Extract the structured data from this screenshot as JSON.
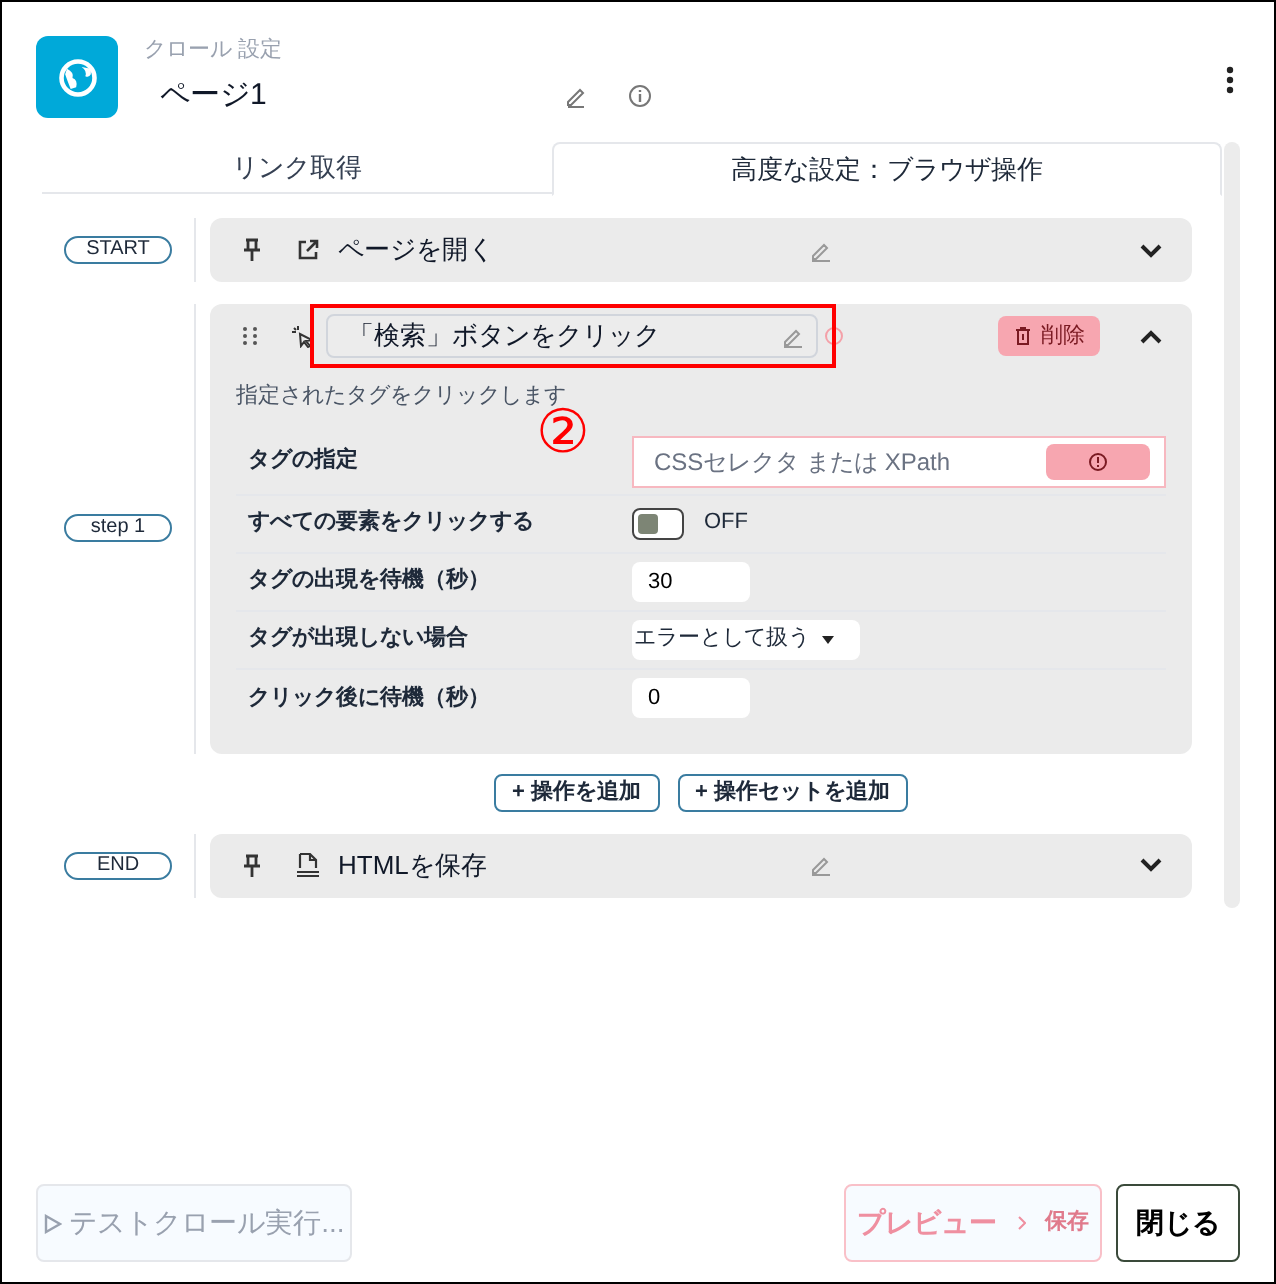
{
  "header": {
    "subtitle": "クロール 設定",
    "title": "ページ1"
  },
  "tabs": [
    {
      "label": "リンク取得",
      "selected": false
    },
    {
      "label": "高度な設定：ブラウザ操作",
      "selected": true
    }
  ],
  "steps": [
    {
      "badge": "START",
      "kind": "open_page",
      "title": "ページを開く",
      "expanded": false
    },
    {
      "badge": "step 1",
      "kind": "click",
      "title": "「検索」ボタンをクリック",
      "expanded": true,
      "highlighted": true,
      "delete_label": "削除",
      "description": "指定されたタグをクリックします",
      "annotation": "②",
      "fields": [
        {
          "kind": "selector",
          "label": "タグの指定",
          "placeholder": "CSSセレクタ または XPath",
          "invalid": true
        },
        {
          "kind": "toggle",
          "label": "すべての要素をクリックする",
          "on": false,
          "state_label": "OFF"
        },
        {
          "kind": "number",
          "label": "タグの出現を待機（秒）",
          "value": "30"
        },
        {
          "kind": "select",
          "label": "タグが出現しない場合",
          "value": "エラーとして扱う"
        },
        {
          "kind": "number",
          "label": "クリック後に待機（秒）",
          "value": "0"
        }
      ]
    },
    {
      "badge": "END",
      "kind": "save_html",
      "title": "HTMLを保存",
      "expanded": false
    }
  ],
  "add_buttons": [
    "+ 操作を追加",
    "+ 操作セットを追加"
  ],
  "footer": {
    "test_button": {
      "label": "テストクロール実行...",
      "disabled": true
    },
    "preview_button": {
      "label": "プレビュー",
      "save_label": "保存",
      "disabled": true
    },
    "close_button": "閉じる"
  }
}
